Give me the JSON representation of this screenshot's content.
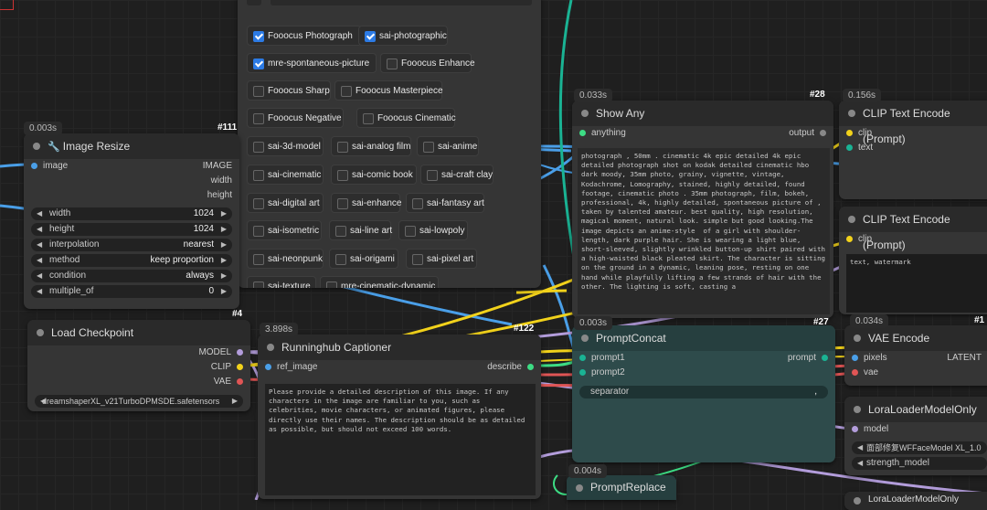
{
  "styles_panel": {
    "checkboxes": [
      {
        "label": "Fooocus Photograph",
        "checked": true
      },
      {
        "label": "sai-photographic",
        "checked": true
      },
      {
        "label": "mre-spontaneous-picture",
        "checked": true
      },
      {
        "label": "Fooocus Enhance",
        "checked": false
      },
      {
        "label": "Fooocus Sharp",
        "checked": false
      },
      {
        "label": "Fooocus Masterpiece",
        "checked": false
      },
      {
        "label": "Fooocus Negative",
        "checked": false
      },
      {
        "label": "Fooocus Cinematic",
        "checked": false
      },
      {
        "label": "sai-3d-model",
        "checked": false
      },
      {
        "label": "sai-analog film",
        "checked": false
      },
      {
        "label": "sai-anime",
        "checked": false
      },
      {
        "label": "sai-cinematic",
        "checked": false
      },
      {
        "label": "sai-comic book",
        "checked": false
      },
      {
        "label": "sai-craft clay",
        "checked": false
      },
      {
        "label": "sai-digital art",
        "checked": false
      },
      {
        "label": "sai-enhance",
        "checked": false
      },
      {
        "label": "sai-fantasy art",
        "checked": false
      },
      {
        "label": "sai-isometric",
        "checked": false
      },
      {
        "label": "sai-line art",
        "checked": false
      },
      {
        "label": "sai-lowpoly",
        "checked": false
      },
      {
        "label": "sai-neonpunk",
        "checked": false
      },
      {
        "label": "sai-origami",
        "checked": false
      },
      {
        "label": "sai-pixel art",
        "checked": false
      },
      {
        "label": "sai-texture",
        "checked": false
      },
      {
        "label": "mre-cinematic-dynamic",
        "checked": false
      }
    ]
  },
  "image_resize": {
    "time": "0.003s",
    "id": "#111",
    "title": "Image Resize",
    "input": "image",
    "outputs": [
      "IMAGE",
      "width",
      "height"
    ],
    "widgets": [
      {
        "label": "width",
        "value": "1024"
      },
      {
        "label": "height",
        "value": "1024"
      },
      {
        "label": "interpolation",
        "value": "nearest"
      },
      {
        "label": "method",
        "value": "keep proportion"
      },
      {
        "label": "condition",
        "value": "always"
      },
      {
        "label": "multiple_of",
        "value": "0"
      }
    ]
  },
  "load_checkpoint": {
    "id": "#4",
    "title": "Load Checkpoint",
    "outputs": [
      "MODEL",
      "CLIP",
      "VAE"
    ],
    "ckpt_name": "dreamshaperXL_v21TurboDPMSDE.safetensors"
  },
  "captioner": {
    "time": "3.898s",
    "id": "#122",
    "title": "Runninghub Captioner",
    "input": "ref_image",
    "output": "describe",
    "prompt": "Please provide a detailed description of this image. If any characters in the image are familiar to you, such as celebrities, movie characters, or animated figures, please directly use their names. The description should be as detailed as possible, but should not exceed 100 words."
  },
  "show_any": {
    "time": "0.033s",
    "id": "#28",
    "title": "Show Any",
    "input": "anything",
    "output": "output",
    "text": "photograph , 50mm . cinematic 4k epic detailed 4k epic detailed photograph shot on kodak detailed cinematic hbo dark moody, 35mm photo, grainy, vignette, vintage, Kodachrome, Lomography, stained, highly detailed, found footage, cinematic photo . 35mm photograph, film, bokeh, professional, 4k, highly detailed, spontaneous picture of , taken by talented amateur. best quality, high resolution, magical moment, natural look. simple but good looking.The image depicts an anime-style  of a girl with shoulder-length, dark purple hair. She is wearing a light blue, short-sleeved, slightly wrinkled button-up shirt paired with a high-waisted black pleated skirt. The character is sitting on the ground in a dynamic, leaning pose, resting on one hand while playfully lifting a few strands of hair with the other. The lighting is soft, casting a"
  },
  "prompt_concat": {
    "time": "0.003s",
    "id": "#27",
    "title": "PromptConcat",
    "inputs": [
      "prompt1",
      "prompt2"
    ],
    "output": "prompt",
    "separator_label": "separator",
    "separator_value": ","
  },
  "prompt_replace": {
    "time": "0.004s",
    "title": "PromptReplace"
  },
  "clip_encode_1": {
    "time": "0.156s",
    "title": "CLIP Text Encode (Prompt)",
    "inputs": [
      "clip",
      "text"
    ]
  },
  "clip_encode_2": {
    "title": "CLIP Text Encode (Prompt)",
    "input": "clip",
    "text": "text, watermark"
  },
  "vae_encode": {
    "time": "0.034s",
    "id": "#1",
    "title": "VAE Encode",
    "inputs": [
      "pixels",
      "vae"
    ],
    "output": "LATENT"
  },
  "lora_loader": {
    "title": "LoraLoaderModelOnly",
    "input": "model",
    "lora_name": "面部修复WFFaceModel XL_1.0",
    "strength_label": "strength_model"
  },
  "lora_loader_2": {
    "title": "LoraLoaderModelOnly"
  },
  "colors": {
    "yellow": "#f2d21b",
    "lavender": "#b39ddb",
    "red": "#e05555",
    "blue": "#4a9fe8",
    "green": "#3ddc84",
    "teal": "#1ab394"
  }
}
